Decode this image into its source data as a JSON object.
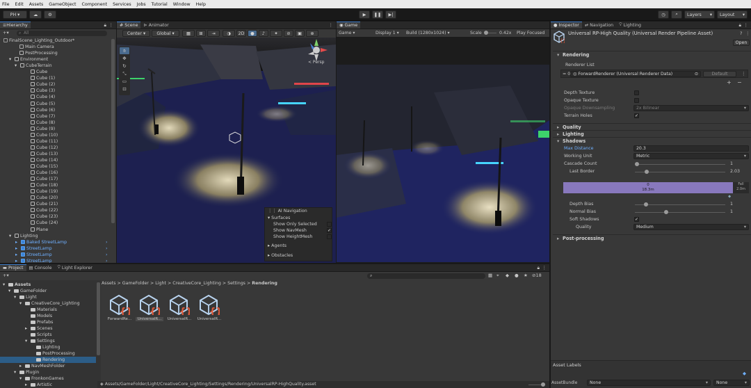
{
  "menu": [
    "File",
    "Edit",
    "Assets",
    "GameObject",
    "Component",
    "Services",
    "Jobs",
    "Tutorial",
    "Window",
    "Help"
  ],
  "toolbar": {
    "account": "PH ▾",
    "layers": "Layers",
    "layout": "Layout"
  },
  "hierarchy": {
    "tab": "Hierarchy",
    "search_placeholder": "All",
    "scene": "FinalScene_Lighting_Outdoor*",
    "items": {
      "main_camera": "Main Camera",
      "post_processing": "PostProcessing",
      "environment": "Environment",
      "cube_terrain": "CubeTerrain",
      "cubes": [
        "Cube",
        "Cube (1)",
        "Cube (2)",
        "Cube (3)",
        "Cube (4)",
        "Cube (5)",
        "Cube (6)",
        "Cube (7)",
        "Cube (8)",
        "Cube (9)",
        "Cube (10)",
        "Cube (11)",
        "Cube (12)",
        "Cube (13)",
        "Cube (14)",
        "Cube (15)",
        "Cube (16)",
        "Cube (17)",
        "Cube (18)",
        "Cube (19)",
        "Cube (20)",
        "Cube (21)",
        "Cube (22)",
        "Cube (23)",
        "Cube (24)"
      ],
      "plane": "Plane",
      "lighting": "Lighting",
      "lamps": [
        "Baked StreetLamp",
        "StreetLamp",
        "StreetLamp",
        "StreetLamp"
      ]
    }
  },
  "scene_view": {
    "tabs": [
      "Scene",
      "Animator"
    ],
    "pivot": "Center",
    "space": "Global",
    "mode_2d": "2D",
    "persp": "< Persp",
    "ai_nav": {
      "title": "AI Navigation",
      "surfaces": "Surfaces",
      "show_only_selected": "Show Only Selected",
      "show_navmesh": "Show NavMesh",
      "show_heightmesh": "Show HeightMesh",
      "agents": "Agents",
      "obstacles": "Obstacles"
    }
  },
  "game_view": {
    "tab": "Game",
    "mode": "Game",
    "display": "Display 1",
    "resolution": "Build (1280x1024)",
    "scale_label": "Scale",
    "scale_value": "0.42x",
    "play_focused": "Play Focused"
  },
  "project": {
    "tabs": [
      "Project",
      "Console",
      "Light Explorer"
    ],
    "breadcrumb": [
      "Assets",
      "GameFolder",
      "Light",
      "CreativeCore_Lighting",
      "Settings",
      "Rendering"
    ],
    "tree": [
      "Assets",
      "GameFolder",
      "Light",
      "CreativeCore_Lighting",
      "Materials",
      "Models",
      "Prefabs",
      "Scenes",
      "Scripts",
      "Settings",
      "Lighting",
      "PostProcessing",
      "Rendering",
      "NavMeshFolder",
      "Plugin",
      "FronkonGames",
      "Artistic"
    ],
    "assets": [
      "ForwardRe...",
      "UniversalR...",
      "UniversalR...",
      "UniversalR..."
    ],
    "path": "Assets/GameFolder/Light/CreativeCore_Lighting/Settings/Rendering/UniversalRP-HighQuality.asset",
    "count": "18"
  },
  "inspector": {
    "tabs": [
      "Inspector",
      "Navigation",
      "Lighting"
    ],
    "title": "Universal RP-High Quality (Universal Render Pipeline Asset)",
    "open": "Open",
    "rendering": "Rendering",
    "renderer_list": "Renderer List",
    "renderer_index": "0",
    "renderer_value": "ForwardRenderer (Universal Renderer Data)",
    "renderer_default": "Default",
    "depth_texture": "Depth Texture",
    "opaque_texture": "Opaque Texture",
    "opaque_downsampling": "Opaque Downsampling",
    "opaque_downsampling_value": "2x Bilinear",
    "terrain_holes": "Terrain Holes",
    "quality": "Quality",
    "lighting": "Lighting",
    "shadows": "Shadows",
    "max_distance": "Max Distance",
    "max_distance_value": "20.3",
    "working_unit": "Working Unit",
    "working_unit_value": "Metric",
    "cascade_count": "Cascade Count",
    "cascade_count_value": "1",
    "last_border": "Last Border",
    "last_border_value": "2.03",
    "cascade_bar_index": "0",
    "cascade_bar_distance": "18.3m",
    "cascade_bar_end": "Fall\n2.0m",
    "depth_bias": "Depth Bias",
    "depth_bias_value": "1",
    "normal_bias": "Normal Bias",
    "normal_bias_value": "1",
    "soft_shadows": "Soft Shadows",
    "quality_label": "Quality",
    "quality_value": "Medium",
    "post_processing": "Post-processing",
    "asset_labels": "Asset Labels",
    "asset_bundle": "AssetBundle",
    "asset_bundle_value": "None",
    "asset_bundle_variant": "None"
  },
  "colors": {
    "accent": "#3d7cc9",
    "selection": "#2c5d87",
    "prefab": "#3d85d8",
    "cascade": "#8878bd"
  }
}
